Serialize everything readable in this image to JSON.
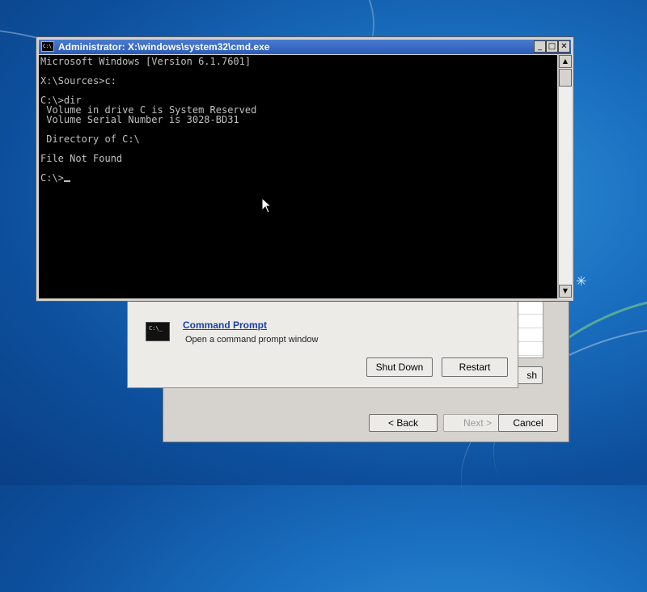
{
  "cmd_window": {
    "title": "Administrator: X:\\windows\\system32\\cmd.exe",
    "icon_label": "C:\\",
    "controls": {
      "minimize": "_",
      "maximize": "□",
      "close": "✕"
    },
    "scroll_arrows": {
      "up": "▲",
      "down": "▼"
    },
    "console_lines": [
      "Microsoft Windows [Version 6.1.7601]",
      "",
      "X:\\Sources>c:",
      "",
      "C:\\>dir",
      " Volume in drive C is System Reserved",
      " Volume Serial Number is 3028-BD31",
      "",
      " Directory of C:\\",
      "",
      "File Not Found",
      "",
      "C:\\>"
    ]
  },
  "recovery": {
    "tool_icon_label": "C:\\_",
    "command_prompt_link": "Command Prompt",
    "command_prompt_desc": "Open a command prompt window",
    "shutdown_label": "Shut Down",
    "restart_label": "Restart"
  },
  "setup": {
    "back_label": "< Back",
    "next_label": "Next >",
    "cancel_label": "Cancel",
    "refresh_partial": "sh"
  },
  "colors": {
    "console_bg": "#000000",
    "console_text": "#c0c0c0",
    "title_bar": "#2a5bb8",
    "link": "#1a3fa8"
  }
}
